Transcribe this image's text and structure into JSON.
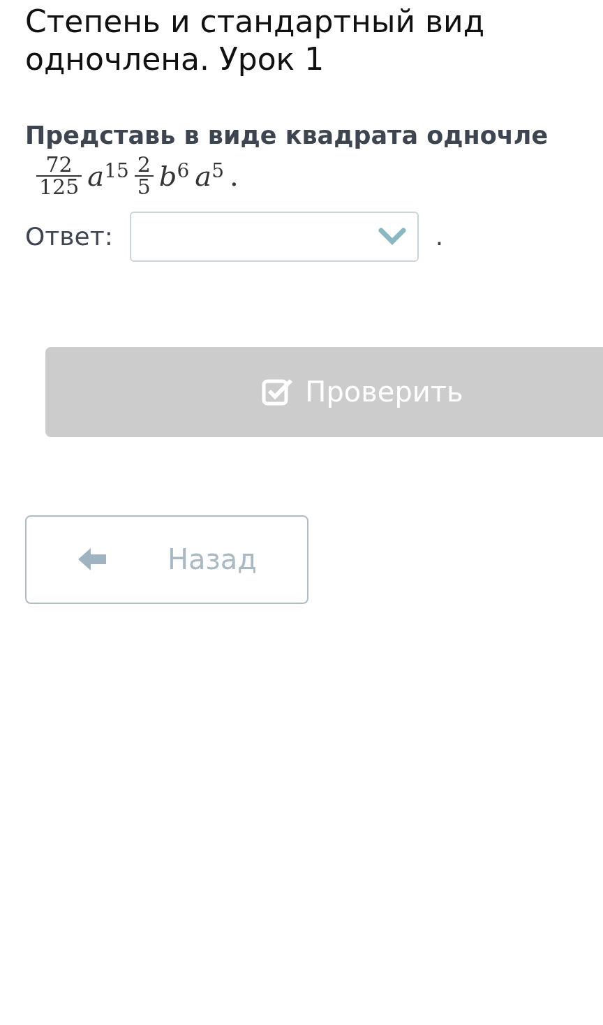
{
  "title_lines": [
    "Степень и стандартный вид",
    "одночлена. Урок 1"
  ],
  "question": "Представь в виде квадрата одночле",
  "expression": [
    {
      "kind": "fraction",
      "numerator": "72",
      "denominator": "125"
    },
    {
      "kind": "power",
      "base": "a",
      "exponent": "15"
    },
    {
      "kind": "fraction",
      "numerator": "2",
      "denominator": "5"
    },
    {
      "kind": "power",
      "base": "b",
      "exponent": "6"
    },
    {
      "kind": "power",
      "base": "a",
      "exponent": "5"
    },
    {
      "kind": "text",
      "text": "."
    }
  ],
  "answer": {
    "label": "Ответ:",
    "after": "."
  },
  "check_button": {
    "label": "Проверить",
    "disabled": true
  },
  "back_button": {
    "label": "Назад"
  }
}
